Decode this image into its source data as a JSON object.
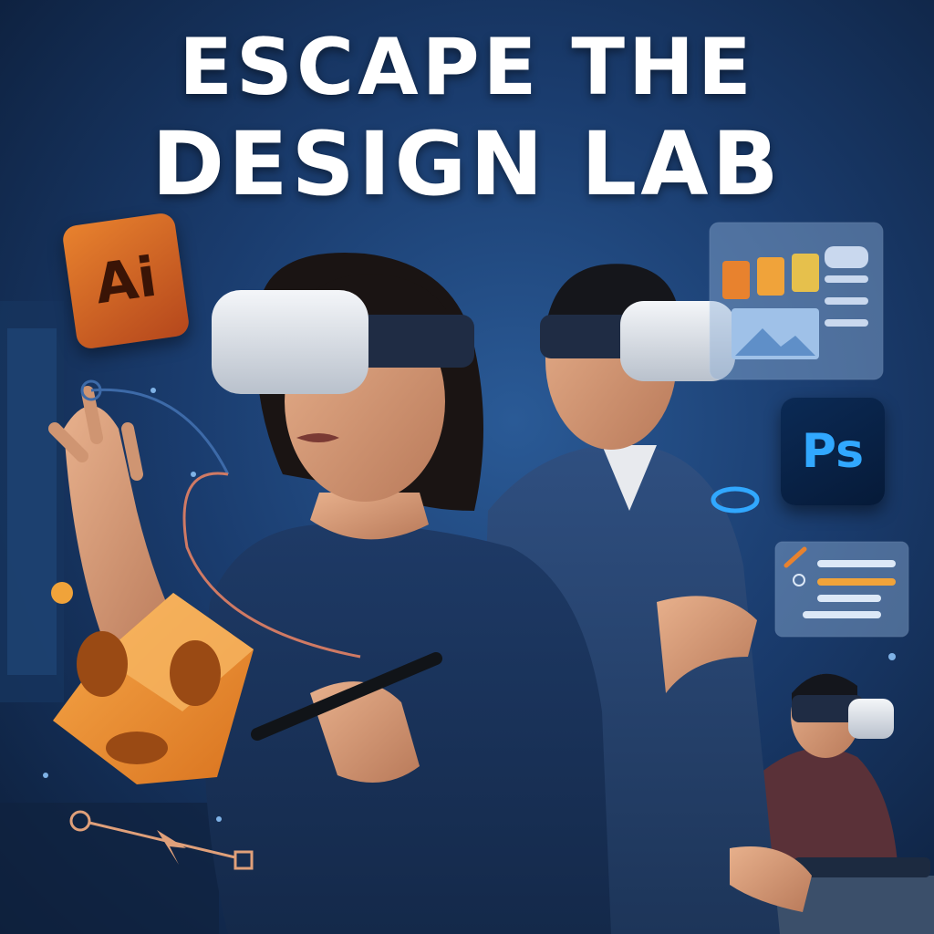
{
  "headline": {
    "line1": "ESCAPE THE",
    "line2": "DESIGN LAB"
  },
  "floating_icons": {
    "illustrator": "Ai",
    "photoshop": "Ps"
  },
  "palette": {
    "background": "#1a3c6e",
    "accent_orange": "#e8822e",
    "photoshop_blue": "#31a8ff",
    "headset_white": "#e4e8ee"
  }
}
